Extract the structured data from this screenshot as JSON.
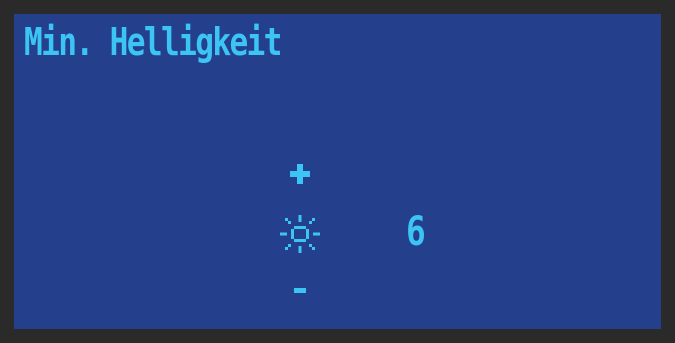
{
  "menu": {
    "title": "Min. Helligkeit"
  },
  "brightness": {
    "value": "6",
    "icon": "sun-icon",
    "increase_icon": "plus-icon",
    "decrease_icon": "minus-icon"
  },
  "colors": {
    "screen_background": "#243f8c",
    "text": "#3cc4f5",
    "bezel": "#2a2a2a"
  }
}
